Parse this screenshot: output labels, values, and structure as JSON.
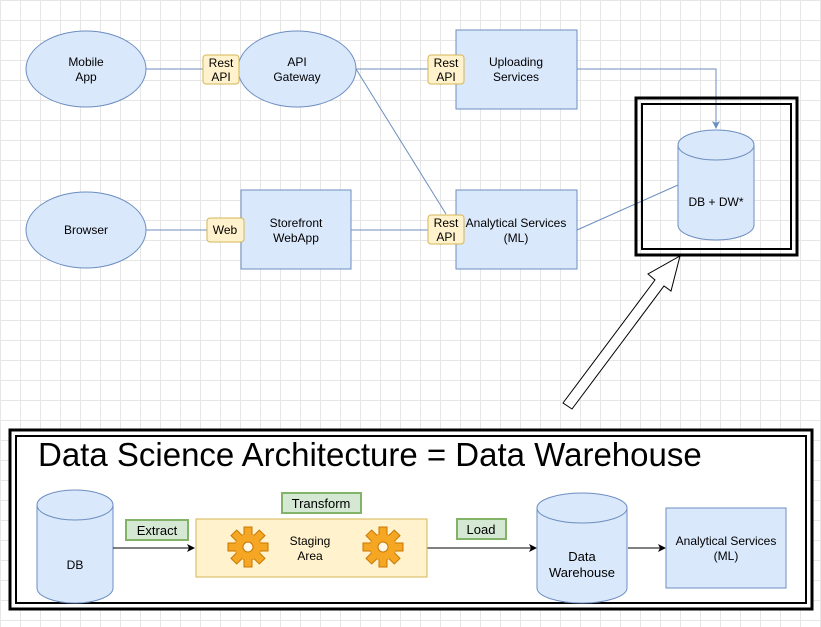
{
  "nodes": {
    "mobile_app": [
      "Mobile",
      "App"
    ],
    "browser": [
      "Browser"
    ],
    "api_gateway": [
      "API",
      "Gateway"
    ],
    "storefront": [
      "Storefront",
      "WebApp"
    ],
    "uploading": [
      "Uploading",
      "Services"
    ],
    "analytical_top": [
      "Analytical Services",
      "(ML)"
    ],
    "db_dw": [
      "DB + DW*"
    ]
  },
  "tags": {
    "rest_api_1": [
      "Rest",
      "API"
    ],
    "rest_api_2": [
      "Rest",
      "API"
    ],
    "rest_api_3": [
      "Rest",
      "API"
    ],
    "web": [
      "Web"
    ]
  },
  "bottom": {
    "title": "Data Science Architecture = Data Warehouse",
    "db": [
      "DB"
    ],
    "extract": "Extract",
    "transform": "Transform",
    "staging": [
      "Staging",
      "Area"
    ],
    "load": "Load",
    "data_warehouse": [
      "Data",
      "Warehouse"
    ],
    "analytical": [
      "Analytical Services",
      "(ML)"
    ]
  },
  "colors": {
    "node_fill": "#dae8fc",
    "node_stroke": "#6c8ebf",
    "tag_fill": "#fff2cc",
    "tag_stroke": "#d6b656",
    "green_fill": "#d5e8d4",
    "green_stroke": "#82b366",
    "gear": "#f5a623"
  }
}
